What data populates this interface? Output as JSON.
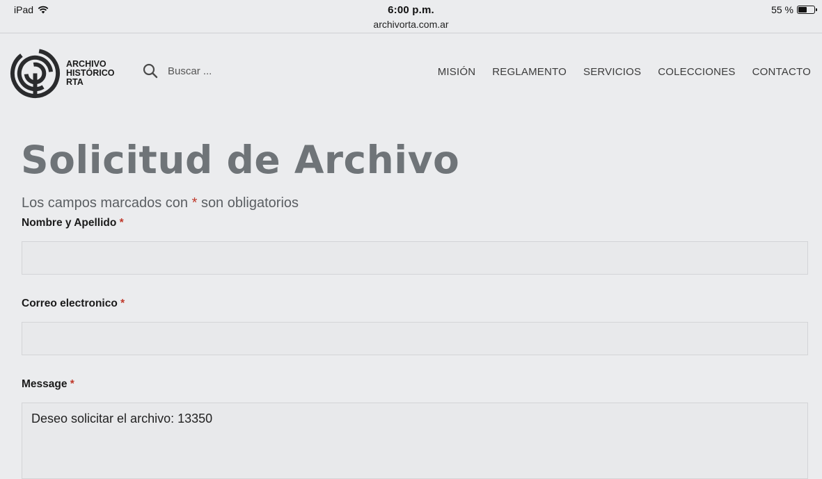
{
  "status_bar": {
    "device": "iPad",
    "time": "6:00 p.m.",
    "url": "archivorta.com.ar",
    "battery": "55 %",
    "battery_level": 0.55
  },
  "header": {
    "logo": {
      "line1": "ARCHIVO",
      "line2": "HISTÓRICO",
      "line3": "RTA"
    },
    "search": {
      "placeholder": "Buscar ..."
    },
    "nav": [
      {
        "label": "MISIÓN"
      },
      {
        "label": "REGLAMENTO"
      },
      {
        "label": "SERVICIOS"
      },
      {
        "label": "COLECCIONES"
      },
      {
        "label": "CONTACTO"
      }
    ]
  },
  "form": {
    "title": "Solicitud de Archivo",
    "intro_before": "Los campos marcados con",
    "required_mark": "*",
    "intro_after": "son obligatorios",
    "fields": [
      {
        "label": "Nombre y Apellido",
        "value": ""
      },
      {
        "label": "Correo electronico",
        "value": ""
      },
      {
        "label": "Message",
        "value": "Deseo solicitar el archivo: 13350"
      }
    ]
  }
}
